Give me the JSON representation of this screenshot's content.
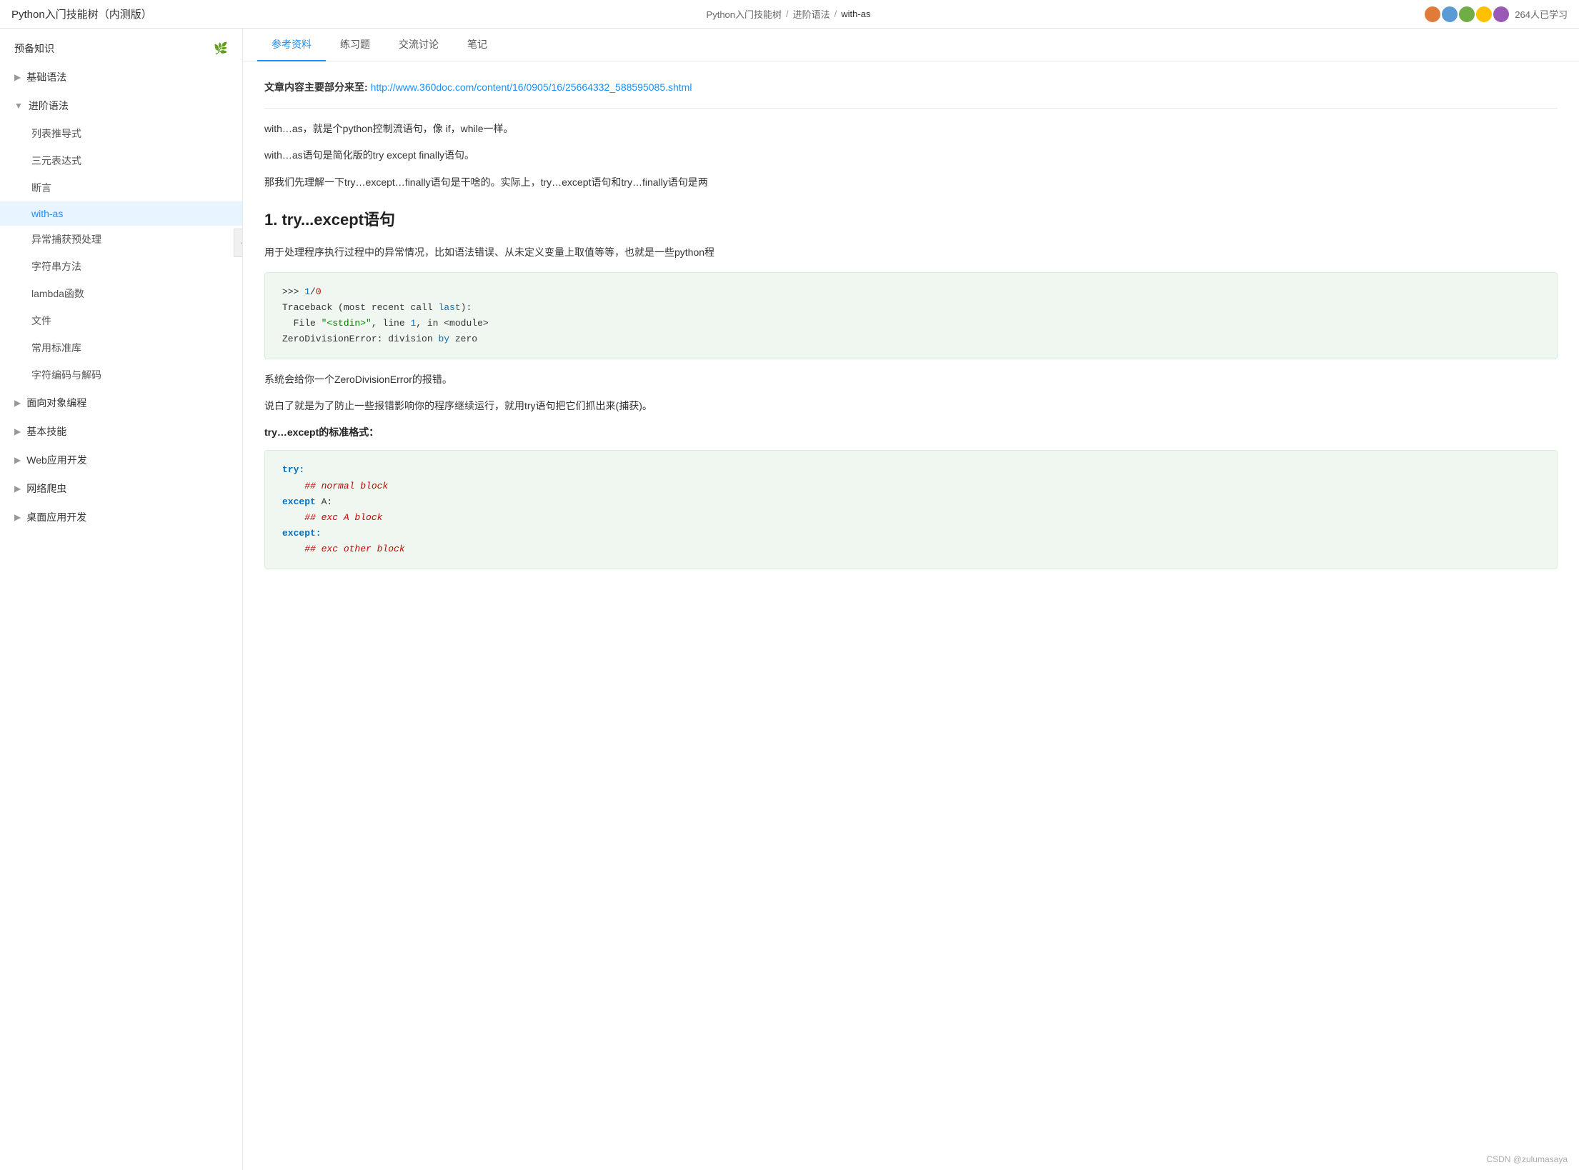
{
  "topbar": {
    "title": "Python入门技能树（内测版）",
    "breadcrumb": {
      "part1": "Python入门技能树",
      "sep1": "/",
      "part2": "进阶语法",
      "sep2": "/",
      "part3": "with-as"
    },
    "user_count": "264人已学习",
    "watermark": "CSDN @zulumasaya"
  },
  "sidebar": {
    "sections": [
      {
        "id": "preknowledge",
        "label": "预备知识",
        "type": "group-leaf",
        "has_icon": true,
        "expanded": false
      },
      {
        "id": "basic-syntax",
        "label": "基础语法",
        "type": "group",
        "expanded": false
      },
      {
        "id": "advanced-syntax",
        "label": "进阶语法",
        "type": "group",
        "expanded": true,
        "children": [
          {
            "id": "list-comp",
            "label": "列表推导式"
          },
          {
            "id": "ternary",
            "label": "三元表达式"
          },
          {
            "id": "assert",
            "label": "断言"
          },
          {
            "id": "with-as",
            "label": "with-as",
            "active": true
          },
          {
            "id": "exception",
            "label": "异常捕获预处理"
          },
          {
            "id": "string-methods",
            "label": "字符串方法"
          },
          {
            "id": "lambda",
            "label": "lambda函数"
          },
          {
            "id": "file",
            "label": "文件"
          },
          {
            "id": "stdlib",
            "label": "常用标准库"
          },
          {
            "id": "encoding",
            "label": "字符编码与解码"
          }
        ]
      },
      {
        "id": "oop",
        "label": "面向对象编程",
        "type": "group",
        "expanded": false
      },
      {
        "id": "basic-skills",
        "label": "基本技能",
        "type": "group",
        "expanded": false
      },
      {
        "id": "web-dev",
        "label": "Web应用开发",
        "type": "group",
        "expanded": false
      },
      {
        "id": "web-crawler",
        "label": "网络爬虫",
        "type": "group",
        "expanded": false
      },
      {
        "id": "desktop-dev",
        "label": "桌面应用开发",
        "type": "group",
        "expanded": false
      }
    ]
  },
  "tabs": [
    {
      "id": "reference",
      "label": "参考资料",
      "active": true
    },
    {
      "id": "exercises",
      "label": "练习题",
      "active": false
    },
    {
      "id": "discussion",
      "label": "交流讨论",
      "active": false
    },
    {
      "id": "notes",
      "label": "笔记",
      "active": false
    }
  ],
  "article": {
    "source_prefix": "文章内容主要部分来至:",
    "source_url": "http://www.360doc.com/content/16/0905/16/25664332_588595085.shtml",
    "intro1": "with…as，就是个python控制流语句，像 if，while一样。",
    "intro2": "with…as语句是简化版的try except finally语句。",
    "intro3": "那我们先理解一下try…except…finally语句是干啥的。实际上，try…except语句和try…finally语句是两",
    "section1_title": "1. try...except语句",
    "section1_desc": "用于处理程序执行过程中的异常情况，比如语法错误、从未定义变量上取值等等，也就是一些python程",
    "code1": {
      "lines": [
        {
          "text": ">>> 1/0",
          "parts": [
            {
              "t": ">>> ",
              "cls": ""
            },
            {
              "t": "1",
              "cls": "num"
            },
            {
              "t": "/",
              "cls": ""
            },
            {
              "t": "0",
              "cls": "red"
            }
          ]
        },
        {
          "text": "Traceback (most recent call last):",
          "parts": [
            {
              "t": "Traceback (most recent call ",
              "cls": ""
            },
            {
              "t": "last",
              "cls": "blue"
            },
            {
              "t": "):",
              "cls": ""
            }
          ]
        },
        {
          "text": "  File \"<stdin>\", line 1, in <module>",
          "parts": [
            {
              "t": "  File ",
              "cls": ""
            },
            {
              "t": "\"<stdin>\"",
              "cls": "green"
            },
            {
              "t": ", line ",
              "cls": ""
            },
            {
              "t": "1",
              "cls": "blue"
            },
            {
              "t": ", in <module>",
              "cls": ""
            }
          ]
        },
        {
          "text": "ZeroDivisionError: division by zero",
          "parts": [
            {
              "t": "ZeroDivisionError: division ",
              "cls": ""
            },
            {
              "t": "by",
              "cls": "blue"
            },
            {
              "t": " zero",
              "cls": ""
            }
          ]
        }
      ]
    },
    "summary1": "系统会给你一个ZeroDivisionError的报错。",
    "summary2": "说白了就是为了防止一些报错影响你的程序继续运行，就用try语句把它们抓出来(捕获)。",
    "format_label": "try…except的标准格式：",
    "code2": {
      "lines": [
        {
          "parts": [
            {
              "t": "try:",
              "cls": "kw"
            }
          ]
        },
        {
          "parts": [
            {
              "t": "    ## normal block",
              "cls": "comment"
            }
          ]
        },
        {
          "parts": [
            {
              "t": "except",
              "cls": "kw"
            },
            {
              "t": " A:",
              "cls": ""
            }
          ]
        },
        {
          "parts": [
            {
              "t": "    ## exc A block",
              "cls": "comment"
            }
          ]
        },
        {
          "parts": [
            {
              "t": "except:",
              "cls": "kw"
            }
          ]
        },
        {
          "parts": [
            {
              "t": "    ## exc other block",
              "cls": "comment"
            }
          ]
        }
      ]
    }
  }
}
